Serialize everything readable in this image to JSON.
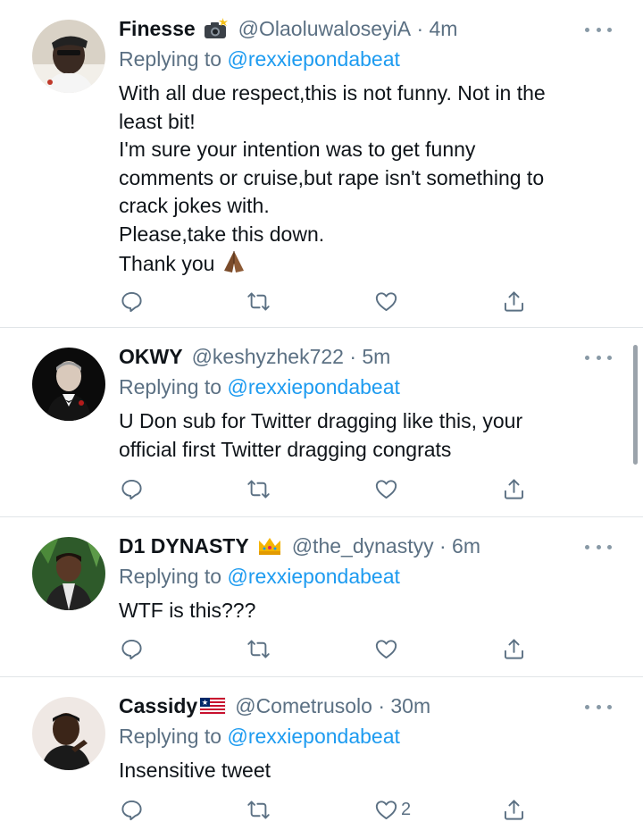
{
  "replying_to_label": "Replying to",
  "tweets": [
    {
      "name": "Finesse",
      "badge": "camera-flash-emoji",
      "handle": "@OlaoluwaloseyiA",
      "time": "· 4m",
      "replying_to": "@rexxiepondabeat",
      "lines": [
        "With all due respect,this is not funny. Not in the",
        "least bit!",
        "I'm sure your intention was to get funny",
        "comments or cruise,but rape isn't something to",
        "crack jokes with.",
        "Please,take this down.",
        "Thank you"
      ],
      "trailing_emoji": "folded-hands-emoji",
      "like_count": ""
    },
    {
      "name": "OKWY",
      "badge": "",
      "handle": "@keshyzhek722",
      "time": "· 5m",
      "replying_to": "@rexxiepondabeat",
      "lines": [
        "U Don sub for Twitter dragging like this, your",
        "official first Twitter dragging congrats"
      ],
      "like_count": ""
    },
    {
      "name": "D1 DYNASTY",
      "badge": "crown-emoji",
      "handle": "@the_dynastyy",
      "time": "· 6m",
      "replying_to": "@rexxiepondabeat",
      "lines": [
        "WTF is this???"
      ],
      "like_count": ""
    },
    {
      "name": "Cassidy",
      "badge": "liberia-flag-emoji",
      "handle": "@Cometrusolo",
      "time": "· 30m",
      "replying_to": "@rexxiepondabeat",
      "lines": [
        "Insensitive tweet"
      ],
      "like_count": "2"
    }
  ],
  "colors": {
    "text": "#0f1419",
    "secondary": "#5b7083",
    "link": "#1d9bf0",
    "divider": "#e1e5e8",
    "icon": "#5b7083"
  },
  "icons": {
    "reply": "reply-icon",
    "retweet": "retweet-icon",
    "like": "like-icon",
    "share": "share-icon",
    "more": "more-icon"
  }
}
